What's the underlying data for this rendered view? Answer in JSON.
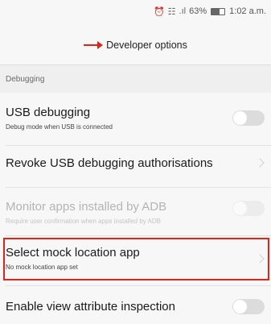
{
  "status_bar": {
    "signal_icons": "⏰ ☷ .ıl",
    "battery_percent": "63%",
    "battery_level": 0.63,
    "time": "1:02 a.m."
  },
  "header": {
    "title": "Developer options",
    "annotation_color": "#e0241a"
  },
  "section": {
    "title": "Debugging"
  },
  "settings": [
    {
      "label": "USB debugging",
      "sub": "Debug mode when USB is connected",
      "control": "toggle",
      "checked": false,
      "enabled": true
    },
    {
      "label": "Revoke USB debugging authorisations",
      "control": "chevron",
      "enabled": true
    },
    {
      "label": "Monitor apps installed by ADB",
      "sub": "Require user confirmation when apps installed by ADB",
      "control": "toggle",
      "checked": false,
      "enabled": false
    },
    {
      "label": "Select mock location app",
      "sub": "No mock location app set",
      "control": "chevron",
      "enabled": true,
      "highlighted": true
    },
    {
      "label": "Enable view attribute inspection",
      "control": "toggle",
      "checked": false,
      "enabled": true
    }
  ]
}
